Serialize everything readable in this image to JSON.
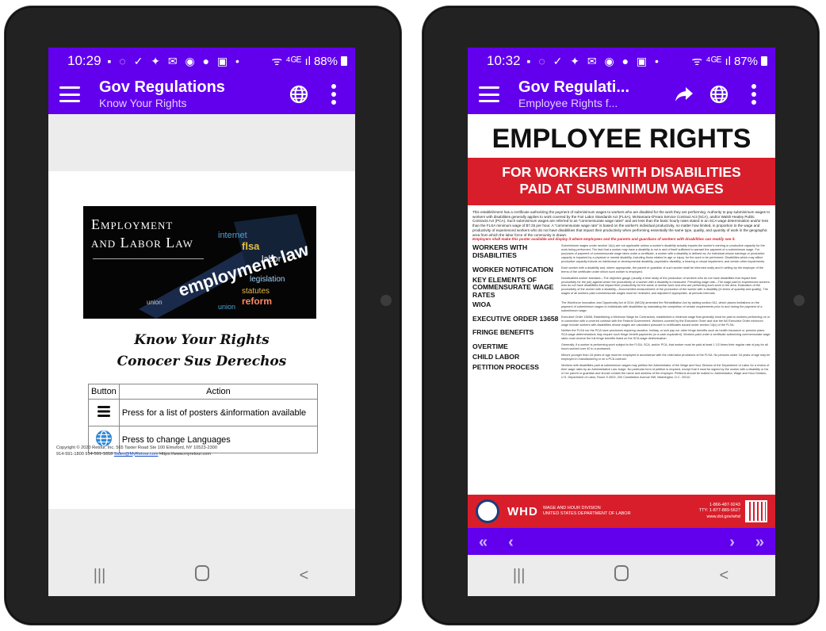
{
  "left": {
    "status": {
      "time": "10:29",
      "icons": "▪ ◌ ✓ ✦ ✉ ◉ ● ▣ •",
      "signal": "ᯤ ⁴ᴳᴱ ıl",
      "battery": "88%"
    },
    "appbar": {
      "title": "Gov Regulations",
      "subtitle": "Know Your Rights"
    },
    "banner": {
      "title_line1": "Employment",
      "title_line2": "and Labor Law"
    },
    "kyr": {
      "line1": "Know Your Rights",
      "line2": "Conocer Sus Derechos"
    },
    "table": {
      "headers": [
        "Button",
        "Action"
      ],
      "rows": [
        {
          "icon": "menu-icon",
          "action": "Press for a list of posters &information available"
        },
        {
          "icon": "globe-icon",
          "action": "Press to change Languages"
        }
      ]
    },
    "copyright": {
      "line1": "Copyright © 2020 Retour, Inc. 565 Taxter Road Ste 100 Elmsford, NY 10523-2300",
      "line2_pre": "914-591-1800 914-591-1818 ",
      "email": "Sales@MyRetour.com",
      "line2_post": " Https://www.myretour.com"
    }
  },
  "right": {
    "status": {
      "time": "10:32",
      "icons": "▪ ◌ ✓ ✦ ✉ ◉ ● ▣ •",
      "signal": "ᯤ ⁴ᴳᴱ ıl",
      "battery": "87%"
    },
    "appbar": {
      "title": "Gov Regulati...",
      "subtitle": "Employee Rights f..."
    },
    "poster": {
      "heading": "EMPLOYEE RIGHTS",
      "band_line1": "FOR WORKERS WITH DISABILITIES",
      "band_line2": "PAID AT SUBMINIMUM WAGES",
      "intro": "This establishment has a certificate authorizing the payment of subminimum wages to workers who are disabled for the work they are performing. Authority to pay subminimum wages to workers with disabilities generally applies to work covered by the Fair Labor Standards Act (FLSA), McNamara-O'Hara Service Contract Act (SCA), and/or Walsh-Healey Public Contracts Act (PCA). Such subminimum wages are referred to as \"commensurate wage rates\" and are less than the basic hourly rates stated in an SCA wage determination and/or less than the FLSA minimum wage of $7.25 per hour. A \"commensurate wage rate\" is based on the worker's individual productivity, no matter how limited, in proportion to the wage and productivity of experienced workers who do not have disabilities that impact their productivity when performing essentially the same type, quality, and quantity of work in the geographic area from which the labor force of the community is drawn.",
      "intro_red": "Employers shall make this poster available and display it where employees and the parents and guardians of workers with disabilities can readily see it.",
      "sections": [
        {
          "h": "Workers With Disabilities",
          "b": "Subminimum wages under section 14(c) are not applicable unless a worker's disability actually impairs the worker's earning or productive capacity for the work being performed. The fact that a worker may have a disability is not in and of itself sufficient to warrant the payment of a subminimum wage. For purposes of payment of commensurate wage rates under a certificate, a worker with a disability is defined as: An individual whose earnings or productive capacity is impaired by a physical or mental disability, including those related to age or injury, for the work to be performed. Disabilities which may affect productive capacity include an intellectual or developmental disability, psychiatric disability, a hearing or visual impairment, and certain other impairments."
        },
        {
          "h": "Worker Notification",
          "b": "Each worker with a disability and, where appropriate, the parent or guardian of such worker shall be informed orally and in writing by the employer of the terms of the certificate under which such worker is employed."
        },
        {
          "h": "Key Elements of Commensurate Wage Rates",
          "b": "Nondisabled worker standard—The objective gauge (usually a time study of the production of workers who do not have disabilities that impact their productivity for the job) against which the productivity of a worker with a disability is measured. Prevailing wage rate—The wage paid to experienced workers who do not have disabilities that impact their productivity for the same or similar work and who are performing such work in the area. Evaluation of the productivity of the worker with a disability—Documented measurement of the production of the worker with a disability (in terms of quantity and quality). The wages of all workers paid commensurate wages must be reviewed, and adjusted if appropriate, at periodic intervals."
        },
        {
          "h": "WIOA",
          "b": "The Workforce Innovation and Opportunity Act of 2014 (WIOA) amended the Rehabilitation Act by adding section 511, which places limitations on the payment of subminimum wages to individuals with disabilities by mandating the completion of certain requirements prior to and during the payment of a subminimum wage."
        },
        {
          "h": "Executive Order 13658",
          "b": "Executive Order 13658, Establishing a Minimum Wage for Contractors, established a minimum wage that generally must be paid to workers performing on or in connection with a covered contract with the Federal Government. Workers covered by the Executive Order and due the full Executive Order minimum wage include workers with disabilities whose wages are calculated pursuant to certificates issued under section 14(c) of the FLSA."
        },
        {
          "h": "Fringe Benefits",
          "b": "Neither the FLSA nor the PCA have provisions requiring vacation, holiday, or sick pay nor other fringe benefits such as health insurance or pension plans. SCA wage determinations may require such fringe benefit payments (or a cash equivalent). Workers paid under a certificate authorizing commensurate wage rates must receive the full fringe benefits listed on the SCA wage determination."
        },
        {
          "h": "Overtime",
          "b": "Generally, if a worker is performing work subject to the FLSA, SCA, and/or PCA, that worker must be paid at least 1 1/2 times their regular rate of pay for all hours worked over 40 in a workweek."
        },
        {
          "h": "Child Labor",
          "b": "Minors younger than 18 years of age must be employed in accordance with the child labor provisions of the FLSA. No persons under 16 years of age may be employed in manufacturing or on a PCA contract."
        },
        {
          "h": "Petition Process",
          "b": "Workers with disabilities paid at subminimum wages may petition the Administrator of the Wage and Hour Division of the Department of Labor for a review of their wage rates by an Administrative Law Judge. No particular form of petition is required, except that it must be signed by the worker with a disability or his or her parent or guardian and should contain the name and address of the employer. Petitions should be mailed to: Administrator, Wage and Hour Division, U.S. Department of Labor, Room S-3502, 200 Constitution Avenue NW, Washington, D.C. 20210."
        }
      ],
      "footer": {
        "whd": "WHD",
        "division": "WAGE AND HOUR DIVISION",
        "department": "UNITED STATES DEPARTMENT OF LABOR",
        "phone": "1-866-487-9243",
        "tty": "TTY: 1-877-889-5627",
        "web": "www.dol.gov/whd"
      }
    },
    "pager": {
      "first": "«",
      "prev": "‹",
      "next": "›",
      "last": "»"
    }
  },
  "colors": {
    "accent": "#6200ee",
    "poster_red": "#d91e2b"
  }
}
